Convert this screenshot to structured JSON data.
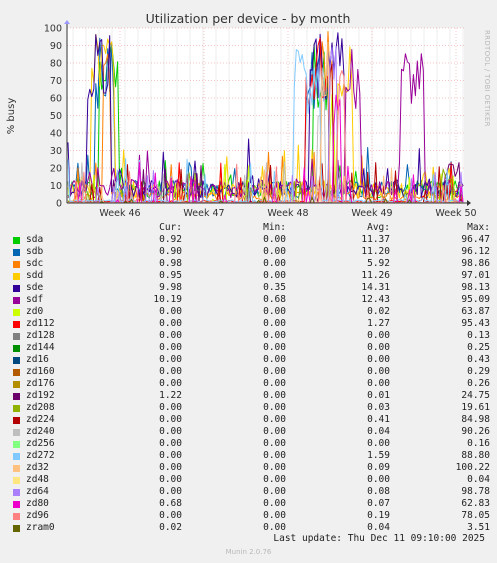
{
  "chart_data": {
    "type": "line",
    "title": "Utilization per device - by month",
    "ylabel": "% busy",
    "ylim": [
      0,
      100
    ],
    "y_ticks": [
      0,
      10,
      20,
      30,
      40,
      50,
      60,
      70,
      80,
      90,
      100
    ],
    "x_ticks": [
      "Week 46",
      "Week 47",
      "Week 48",
      "Week 49",
      "Week 50"
    ],
    "grid": true,
    "series": [
      {
        "name": "sda",
        "color": "#00cc00",
        "cur": "0.92",
        "min": "0.00",
        "avg": "11.37",
        "max": "96.47"
      },
      {
        "name": "sdb",
        "color": "#0066b3",
        "cur": "0.90",
        "min": "0.00",
        "avg": "11.20",
        "max": "96.12"
      },
      {
        "name": "sdc",
        "color": "#ff8000",
        "cur": "0.98",
        "min": "0.00",
        "avg": "5.92",
        "max": "98.86"
      },
      {
        "name": "sdd",
        "color": "#ffcc00",
        "cur": "0.95",
        "min": "0.00",
        "avg": "11.26",
        "max": "97.01"
      },
      {
        "name": "sde",
        "color": "#330099",
        "cur": "9.98",
        "min": "0.35",
        "avg": "14.31",
        "max": "98.13"
      },
      {
        "name": "sdf",
        "color": "#990099",
        "cur": "10.19",
        "min": "0.68",
        "avg": "12.43",
        "max": "95.09"
      },
      {
        "name": "zd0",
        "color": "#ccff00",
        "cur": "0.00",
        "min": "0.00",
        "avg": "0.02",
        "max": "63.87"
      },
      {
        "name": "zd112",
        "color": "#ff0000",
        "cur": "0.00",
        "min": "0.00",
        "avg": "1.27",
        "max": "95.43"
      },
      {
        "name": "zd128",
        "color": "#808080",
        "cur": "0.00",
        "min": "0.00",
        "avg": "0.00",
        "max": "0.13"
      },
      {
        "name": "zd144",
        "color": "#008f00",
        "cur": "0.00",
        "min": "0.00",
        "avg": "0.00",
        "max": "0.25"
      },
      {
        "name": "zd16",
        "color": "#00487d",
        "cur": "0.00",
        "min": "0.00",
        "avg": "0.00",
        "max": "0.43"
      },
      {
        "name": "zd160",
        "color": "#b35a00",
        "cur": "0.00",
        "min": "0.00",
        "avg": "0.00",
        "max": "0.29"
      },
      {
        "name": "zd176",
        "color": "#b38f00",
        "cur": "0.00",
        "min": "0.00",
        "avg": "0.00",
        "max": "0.26"
      },
      {
        "name": "zd192",
        "color": "#6b006b",
        "cur": "1.22",
        "min": "0.00",
        "avg": "0.01",
        "max": "24.75"
      },
      {
        "name": "zd208",
        "color": "#8fb300",
        "cur": "0.00",
        "min": "0.00",
        "avg": "0.03",
        "max": "19.61"
      },
      {
        "name": "zd224",
        "color": "#b30000",
        "cur": "0.00",
        "min": "0.00",
        "avg": "0.41",
        "max": "84.98"
      },
      {
        "name": "zd240",
        "color": "#bebebe",
        "cur": "0.00",
        "min": "0.00",
        "avg": "0.04",
        "max": "90.26"
      },
      {
        "name": "zd256",
        "color": "#80ff80",
        "cur": "0.00",
        "min": "0.00",
        "avg": "0.00",
        "max": "0.16"
      },
      {
        "name": "zd272",
        "color": "#80c9ff",
        "cur": "0.00",
        "min": "0.00",
        "avg": "1.59",
        "max": "88.80"
      },
      {
        "name": "zd32",
        "color": "#ffc080",
        "cur": "0.00",
        "min": "0.00",
        "avg": "0.09",
        "max": "100.22"
      },
      {
        "name": "zd48",
        "color": "#ffe680",
        "cur": "0.00",
        "min": "0.00",
        "avg": "0.00",
        "max": "0.04"
      },
      {
        "name": "zd64",
        "color": "#aa80ff",
        "cur": "0.00",
        "min": "0.00",
        "avg": "0.08",
        "max": "98.78"
      },
      {
        "name": "zd80",
        "color": "#ee00cc",
        "cur": "0.68",
        "min": "0.00",
        "avg": "0.07",
        "max": "62.83"
      },
      {
        "name": "zd96",
        "color": "#ff8080",
        "cur": "0.00",
        "min": "0.00",
        "avg": "0.19",
        "max": "78.05"
      },
      {
        "name": "zram0",
        "color": "#666600",
        "cur": "0.02",
        "min": "0.00",
        "avg": "0.04",
        "max": "3.51"
      }
    ]
  },
  "legend": {
    "header": {
      "cur": "Cur:",
      "min": "Min:",
      "avg": "Avg:",
      "max": "Max:"
    }
  },
  "footer": {
    "last_update": "Last update: Thu Dec 11 09:10:00 2025",
    "munin_version": "Munin 2.0.76",
    "side_label": "RRDTOOL / TOBI OETIKER"
  }
}
